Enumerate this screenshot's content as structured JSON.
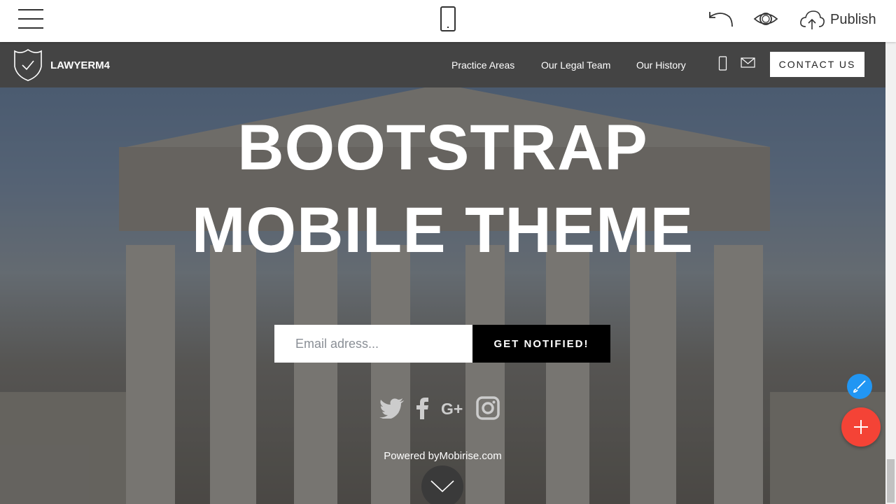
{
  "toolbar": {
    "publish_label": "Publish",
    "icons": [
      "hamburger-menu-icon",
      "mobile-view-icon",
      "undo-icon",
      "preview-eye-icon",
      "cloud-upload-icon"
    ]
  },
  "nav": {
    "brand": "LAWYERM4",
    "links": [
      "Practice Areas",
      "Our Legal Team",
      "Our History"
    ],
    "contact_label": "CONTACT US"
  },
  "hero": {
    "title_line1": "BOOTSTRAP",
    "title_line2": "MOBILE THEME",
    "email_placeholder": "Email adress...",
    "button_label": "GET NOTIFIED!",
    "powered": "Powered byMobirise.com",
    "social": [
      "twitter",
      "facebook",
      "google-plus",
      "instagram"
    ]
  },
  "colors": {
    "nav_bg": "#444444",
    "fab_add": "#f44336",
    "fab_brush": "#2196f3"
  }
}
